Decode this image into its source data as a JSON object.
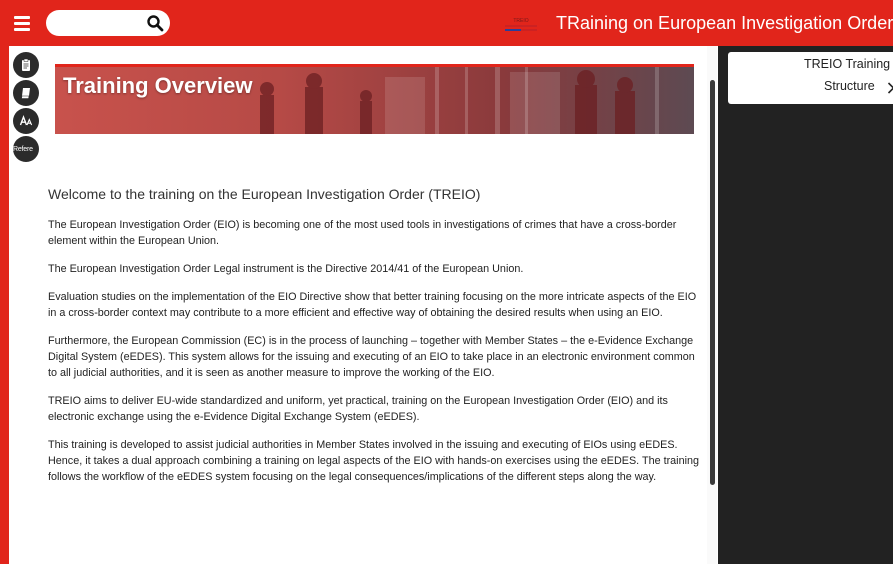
{
  "header": {
    "app_title": "TRaining on European Investigation Order",
    "search_placeholder": "",
    "logo_text": "TREIO"
  },
  "tools": {
    "references_label": "Refere"
  },
  "banner": {
    "title": "Training Overview"
  },
  "article": {
    "heading": "Welcome to the training on the European Investigation Order (TREIO)",
    "paragraphs": [
      "The European Investigation Order (EIO) is becoming one of the most used tools in investigations of crimes that have a cross-border element within the European Union.",
      "The European Investigation Order Legal instrument is the Directive 2014/41 of the European Union.",
      "Evaluation studies on the implementation of the EIO Directive show that better training focusing on the more intricate aspects of the EIO in a cross-border context may contribute to a more efficient and effective way of obtaining the desired results when using an EIO.",
      "Furthermore, the European Commission (EC) is in the process of launching – together with Member States – the e-Evidence Exchange Digital System (eEDES). This system allows for the issuing and executing of an EIO to take place in an electronic environment common to all judicial authorities, and it is seen as another measure to improve the working of the EIO.",
      "TREIO aims to deliver EU-wide standardized and uniform, yet practical, training on the European Investigation Order (EIO) and its electronic exchange using the e-Evidence Digital Exchange System (eEDES).",
      "This training is developed to assist judicial authorities in Member States involved in the issuing and executing of EIOs using eEDES. Hence, it takes a dual approach combining a training on legal aspects of the EIO with hands-on exercises using the eEDES. The training follows the workflow of the eEDES system focusing on the legal consequences/implications of the different steps along the way."
    ]
  },
  "right_panel": {
    "line1": "TREIO Training",
    "line2": "Structure"
  },
  "colors": {
    "brand_red": "#e1251b",
    "panel_dark": "#222222"
  },
  "icons": [
    "menu-icon",
    "search-icon",
    "clipboard-icon",
    "book-icon",
    "font-size-icon",
    "chevron-right-icon"
  ]
}
